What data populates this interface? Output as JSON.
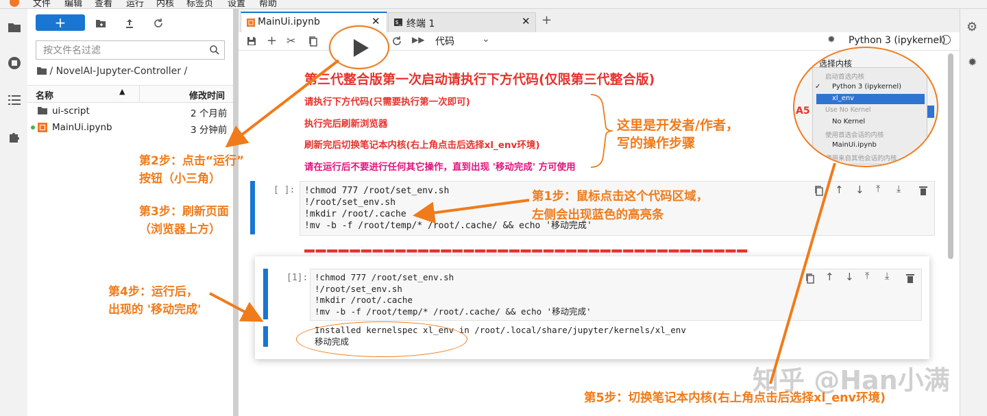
{
  "menubar": {
    "items": [
      "文件",
      "编辑",
      "查看",
      "运行",
      "内核",
      "标签页",
      "设置",
      "帮助"
    ]
  },
  "filebrowser": {
    "new_button": "+",
    "search_placeholder": "按文件名过滤",
    "breadcrumb": "/ NovelAI-Jupyter-Controller /",
    "col_name": "名称",
    "col_modified": "修改时间",
    "files": [
      {
        "name": "ui-script",
        "modified": "2 个月前",
        "icon": "folder-icon"
      },
      {
        "name": "MainUi.ipynb",
        "modified": "3 分钟前",
        "icon": "notebook-icon"
      }
    ]
  },
  "tabs": [
    {
      "label": "MainUi.ipynb",
      "icon": "notebook-icon",
      "active": true
    },
    {
      "label": "终端 1",
      "icon": "terminal-icon",
      "active": false
    }
  ],
  "toolbar": {
    "cell_type": "代码",
    "kernel_name": "Python 3 (ipykernel)"
  },
  "kernel_popup": {
    "title": "选择内核",
    "header_preferred": "启动首选内核",
    "opt_python": "Python 3 (ipykernel)",
    "opt_xl": "xl_env",
    "header_no": "Use No Kernel",
    "opt_no": "No Kernel",
    "header_session": "使用首选会话的内核",
    "opt_session": "MainUi.ipynb",
    "header_other": "使用来自其他会话的内核"
  },
  "markdown": {
    "heading": "第三代整合版第一次启动请执行下方代码(仅限第三代整合版)",
    "line1": "请执行下方代码(只需要执行第一次即可)",
    "line2": "执行完后刷新浏览器",
    "line3": "刷新完后切换笔记本内核(右上角点击后选择xl_env环境)",
    "line4": "请在运行后不要进行任何其它操作，直到出现 '移动完成' 方可使用"
  },
  "cell1": {
    "prompt": "[ ]:",
    "lines": [
      "!chmod 777 /root/set_env.sh",
      "!/root/set_env.sh",
      "!mkdir /root/.cache",
      "!mv -b -f /root/temp/* /root/.cache/ && echo '移动完成'"
    ]
  },
  "cell2": {
    "prompt": "[1]:",
    "lines": [
      "!chmod 777 /root/set_env.sh",
      "!/root/set_env.sh",
      "!mkdir /root/.cache",
      "!mv -b -f /root/temp/* /root/.cache/ && echo '移动完成'"
    ],
    "output_line1": "Installed kernelspec xl_env in /root/.local/share/jupyter/kernels/xl_env",
    "output_line2": "移动完成"
  },
  "annotations": {
    "dev_note_1": "这里是开发者/作者，",
    "dev_note_2": "写的操作步骤",
    "step1_a": "第1步：鼠标点击这个代码区域，",
    "step1_b": "左侧会出现蓝色的高亮条",
    "step2_a": "第2步：点击“运行”",
    "step2_b": "按钮（小三角）",
    "step3_a": "第3步：刷新页面",
    "step3_b": "（浏览器上方）",
    "step4_a": "第4步：运行后，",
    "step4_b": "出现的 '移动完成'",
    "step5": "第5步：切换笔记本内核(右上角点击后选择xl_env环境)"
  },
  "watermark": "知乎 @Han小满",
  "colors": {
    "accent": "#1976d2",
    "annotation": "#f07b1a",
    "heading_red": "#e8322d",
    "magenta": "#e3127b"
  }
}
